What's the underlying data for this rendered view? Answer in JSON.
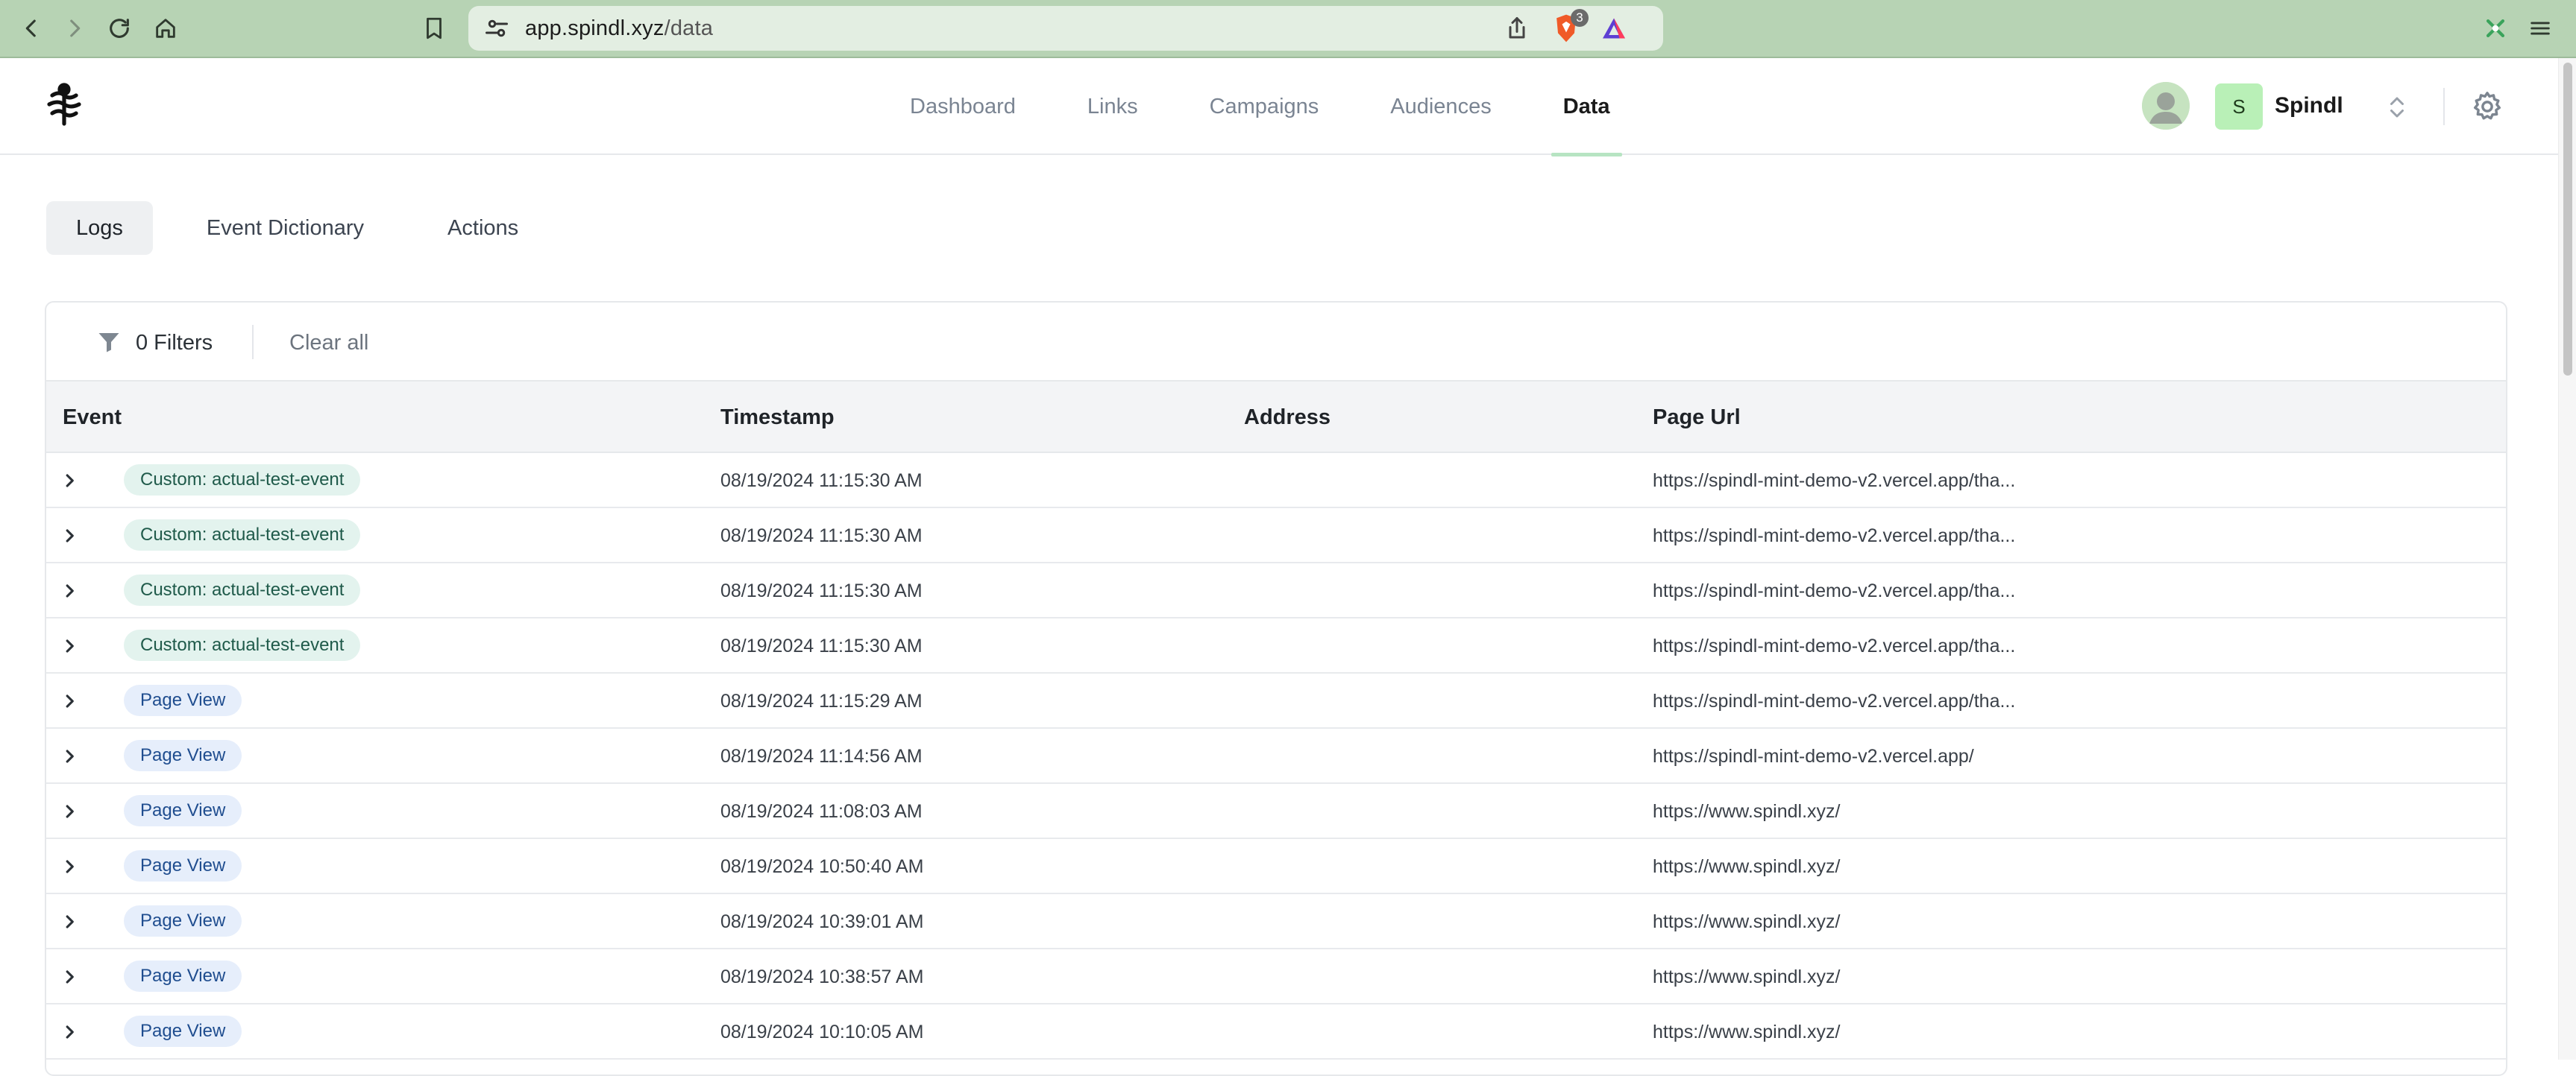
{
  "browser": {
    "url_host": "app.spindl.xyz",
    "url_path": "/data",
    "brave_badge_count": "3"
  },
  "nav": {
    "items": [
      {
        "label": "Dashboard",
        "active": false
      },
      {
        "label": "Links",
        "active": false
      },
      {
        "label": "Campaigns",
        "active": false
      },
      {
        "label": "Audiences",
        "active": false
      },
      {
        "label": "Data",
        "active": true
      }
    ]
  },
  "org": {
    "initial": "S",
    "name": "Spindl"
  },
  "subtabs": [
    {
      "label": "Logs",
      "active": true
    },
    {
      "label": "Event Dictionary",
      "active": false
    },
    {
      "label": "Actions",
      "active": false
    }
  ],
  "filters": {
    "count_label": "0 Filters",
    "clear_label": "Clear all"
  },
  "table": {
    "columns": [
      "Event",
      "Timestamp",
      "Address",
      "Page Url"
    ],
    "rows": [
      {
        "event": "Custom: actual-test-event",
        "type": "custom",
        "timestamp": "08/19/2024 11:15:30 AM",
        "address": "",
        "page_url": "https://spindl-mint-demo-v2.vercel.app/tha..."
      },
      {
        "event": "Custom: actual-test-event",
        "type": "custom",
        "timestamp": "08/19/2024 11:15:30 AM",
        "address": "",
        "page_url": "https://spindl-mint-demo-v2.vercel.app/tha..."
      },
      {
        "event": "Custom: actual-test-event",
        "type": "custom",
        "timestamp": "08/19/2024 11:15:30 AM",
        "address": "",
        "page_url": "https://spindl-mint-demo-v2.vercel.app/tha..."
      },
      {
        "event": "Custom: actual-test-event",
        "type": "custom",
        "timestamp": "08/19/2024 11:15:30 AM",
        "address": "",
        "page_url": "https://spindl-mint-demo-v2.vercel.app/tha..."
      },
      {
        "event": "Page View",
        "type": "pageview",
        "timestamp": "08/19/2024 11:15:29 AM",
        "address": "",
        "page_url": "https://spindl-mint-demo-v2.vercel.app/tha..."
      },
      {
        "event": "Page View",
        "type": "pageview",
        "timestamp": "08/19/2024 11:14:56 AM",
        "address": "",
        "page_url": "https://spindl-mint-demo-v2.vercel.app/"
      },
      {
        "event": "Page View",
        "type": "pageview",
        "timestamp": "08/19/2024 11:08:03 AM",
        "address": "",
        "page_url": "https://www.spindl.xyz/"
      },
      {
        "event": "Page View",
        "type": "pageview",
        "timestamp": "08/19/2024 10:50:40 AM",
        "address": "",
        "page_url": "https://www.spindl.xyz/"
      },
      {
        "event": "Page View",
        "type": "pageview",
        "timestamp": "08/19/2024 10:39:01 AM",
        "address": "",
        "page_url": "https://www.spindl.xyz/"
      },
      {
        "event": "Page View",
        "type": "pageview",
        "timestamp": "08/19/2024 10:38:57 AM",
        "address": "",
        "page_url": "https://www.spindl.xyz/"
      },
      {
        "event": "Page View",
        "type": "pageview",
        "timestamp": "08/19/2024 10:10:05 AM",
        "address": "",
        "page_url": "https://www.spindl.xyz/"
      }
    ]
  }
}
